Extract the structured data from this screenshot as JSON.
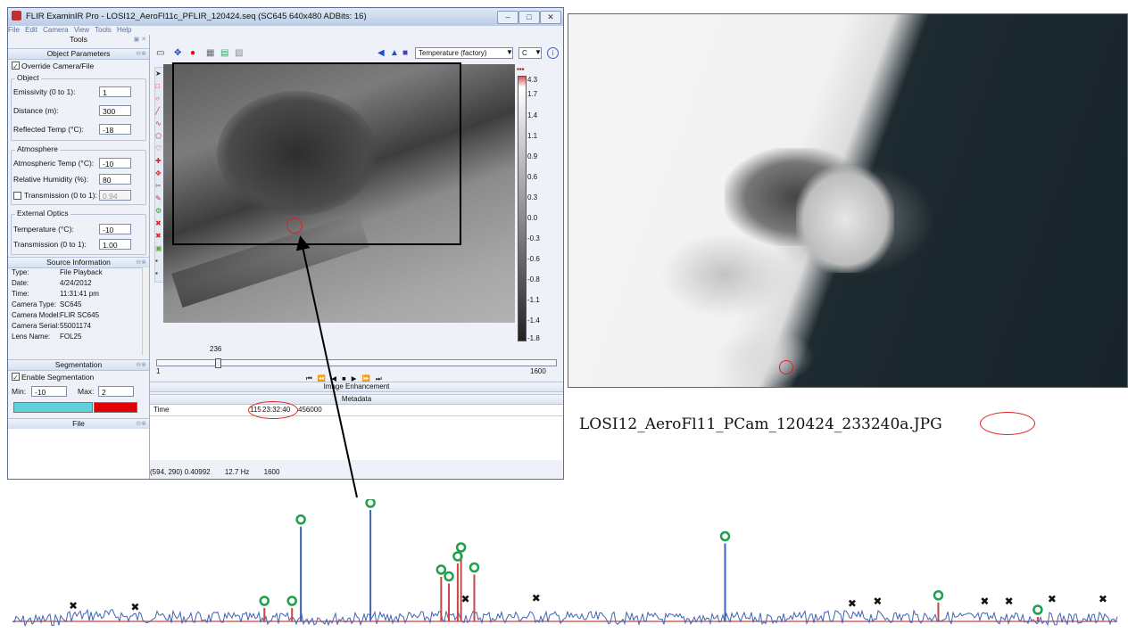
{
  "window": {
    "title": "FLIR ExaminIR Pro - LOSI12_AeroFl11c_PFLIR_120424.seq (SC645 640x480 ADBits: 16)",
    "controls": [
      "–",
      "□",
      "✕"
    ]
  },
  "menu": [
    "File",
    "Edit",
    "Camera",
    "View",
    "Tools",
    "Help"
  ],
  "tools_header": "Tools",
  "object_parameters": {
    "header": "Object Parameters",
    "override_label": "Override Camera/File",
    "object_group": "Object",
    "emissivity_label": "Emissivity (0 to 1):",
    "emissivity_value": "1",
    "distance_label": "Distance (m):",
    "distance_value": "300",
    "reflected_label": "Reflected Temp (°C):",
    "reflected_value": "-18",
    "atmosphere_group": "Atmosphere",
    "atm_temp_label": "Atmospheric Temp (°C):",
    "atm_temp_value": "-10",
    "humidity_label": "Relative Humidity (%):",
    "humidity_value": "80",
    "transmission_label": "Transmission (0 to 1):",
    "transmission_value": "0.94",
    "ext_optics_group": "External Optics",
    "ext_temp_label": "Temperature (°C):",
    "ext_temp_value": "-10",
    "ext_trans_label": "Transmission (0 to 1):",
    "ext_trans_value": "1.00"
  },
  "source_info": {
    "header": "Source Information",
    "rows": [
      {
        "k": "Type:",
        "v": "File Playback"
      },
      {
        "k": "Date:",
        "v": "4/24/2012"
      },
      {
        "k": "Time:",
        "v": "11:31:41 pm"
      },
      {
        "k": "Camera Type:",
        "v": "SC645"
      },
      {
        "k": "Camera Model:",
        "v": "FLIR SC645"
      },
      {
        "k": "Camera Serial:",
        "v": "55001174"
      },
      {
        "k": "Lens Name:",
        "v": "FOL25"
      }
    ]
  },
  "segmentation": {
    "header": "Segmentation",
    "enable_label": "Enable Segmentation",
    "min_label": "Min:",
    "min_value": "-10",
    "max_label": "Max:",
    "max_value": "2",
    "color_low": "#5fd0dc",
    "color_high": "#e00000"
  },
  "file_header": "File",
  "toolbar": {
    "palette_select": "Temperature (factory)",
    "unit_select": "C"
  },
  "colorbar_ticks": [
    "4.3",
    "1.7",
    "1.4",
    "1.1",
    "0.9",
    "0.6",
    "0.3",
    "0.0",
    "-0.3",
    "-0.6",
    "-0.8",
    "-1.1",
    "-1.4",
    "-1.8"
  ],
  "timeline": {
    "current": "236",
    "start": "1",
    "end": "1600",
    "current_fraction": 0.147,
    "controls": "⏮ ⏪ ◀ ■ ▶ ⏩ ⏭"
  },
  "image_enhancement_header": "Image Enhancement",
  "metadata": {
    "header": "Metadata",
    "row_key": "Time",
    "row_prefix": "115",
    "row_time": "23:32:40",
    "row_suffix": "456000"
  },
  "status": {
    "coords": "(594, 290) 0.40992",
    "rate": "12.7 Hz",
    "frames": "1600"
  },
  "photo_caption": {
    "prefix": "LOSI12_AeroFl11_PCam_120424_",
    "mark": "233240",
    "suffix": "a.JPG"
  },
  "colors": {
    "accent_red": "#e02020",
    "plot_line": "#3c64b4",
    "baseline": "#c84646",
    "circle_marker": "#1fa04a"
  },
  "chart_data": {
    "type": "line",
    "title": "",
    "xlabel": "",
    "ylabel": "",
    "circle_markers_x": [
      0.228,
      0.253,
      0.261,
      0.324,
      0.388,
      0.395,
      0.403,
      0.406,
      0.418,
      0.645,
      0.838,
      0.928
    ],
    "circle_markers_height": [
      0.12,
      0.12,
      0.85,
      1.0,
      0.4,
      0.34,
      0.52,
      0.6,
      0.42,
      0.7,
      0.17,
      0.04
    ],
    "cross_markers_x": [
      0.055,
      0.111,
      0.41,
      0.474,
      0.76,
      0.783,
      0.88,
      0.902,
      0.941,
      0.987
    ],
    "cross_markers_height": [
      0.06,
      0.05,
      0.12,
      0.13,
      0.08,
      0.1,
      0.1,
      0.1,
      0.12,
      0.12
    ]
  }
}
